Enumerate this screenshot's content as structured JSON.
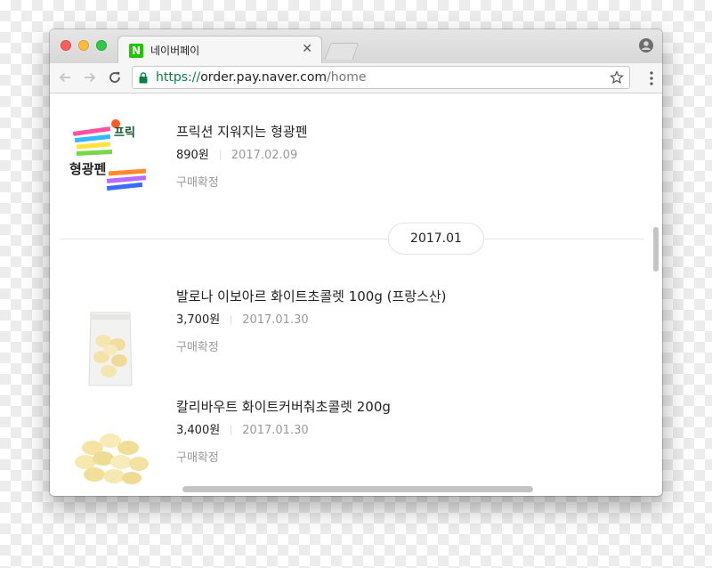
{
  "tab": {
    "title": "네이버페이",
    "favicon_letter": "N",
    "close_glyph": "✕"
  },
  "address_bar": {
    "scheme": "https://",
    "host": "order.pay.naver.com",
    "path": "/home"
  },
  "icons": {
    "back": "arrow-left-icon",
    "forward": "arrow-right-icon",
    "reload": "reload-icon",
    "lock": "lock-icon",
    "star": "star-icon",
    "menu": "more-vert-icon",
    "profile": "profile-icon"
  },
  "colors": {
    "naver_green": "#1ec800",
    "secure_green": "#0b8043",
    "date_gray": "#999999"
  },
  "orders": [
    {
      "title": "프릭션 지워지는 형광펜",
      "price": "890원",
      "date": "2017.02.09",
      "status": "구매확정",
      "image_text": "형광펜"
    },
    {
      "title": "발로나 이보아르 화이트초콜렛 100g (프랑스산)",
      "price": "3,700원",
      "date": "2017.01.30",
      "status": "구매확정"
    },
    {
      "title": "칼리바우트 화이트커버춰초콜렛 200g",
      "price": "3,400원",
      "date": "2017.01.30",
      "status": "구매확정"
    }
  ],
  "month_divider": "2017.01"
}
